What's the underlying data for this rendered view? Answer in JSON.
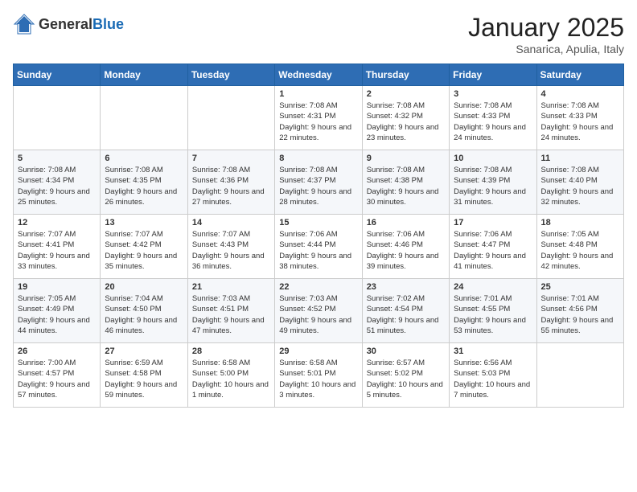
{
  "header": {
    "logo_general": "General",
    "logo_blue": "Blue",
    "month": "January 2025",
    "location": "Sanarica, Apulia, Italy"
  },
  "days_of_week": [
    "Sunday",
    "Monday",
    "Tuesday",
    "Wednesday",
    "Thursday",
    "Friday",
    "Saturday"
  ],
  "weeks": [
    [
      {
        "day": "",
        "info": ""
      },
      {
        "day": "",
        "info": ""
      },
      {
        "day": "",
        "info": ""
      },
      {
        "day": "1",
        "info": "Sunrise: 7:08 AM\nSunset: 4:31 PM\nDaylight: 9 hours and 22 minutes."
      },
      {
        "day": "2",
        "info": "Sunrise: 7:08 AM\nSunset: 4:32 PM\nDaylight: 9 hours and 23 minutes."
      },
      {
        "day": "3",
        "info": "Sunrise: 7:08 AM\nSunset: 4:33 PM\nDaylight: 9 hours and 24 minutes."
      },
      {
        "day": "4",
        "info": "Sunrise: 7:08 AM\nSunset: 4:33 PM\nDaylight: 9 hours and 24 minutes."
      }
    ],
    [
      {
        "day": "5",
        "info": "Sunrise: 7:08 AM\nSunset: 4:34 PM\nDaylight: 9 hours and 25 minutes."
      },
      {
        "day": "6",
        "info": "Sunrise: 7:08 AM\nSunset: 4:35 PM\nDaylight: 9 hours and 26 minutes."
      },
      {
        "day": "7",
        "info": "Sunrise: 7:08 AM\nSunset: 4:36 PM\nDaylight: 9 hours and 27 minutes."
      },
      {
        "day": "8",
        "info": "Sunrise: 7:08 AM\nSunset: 4:37 PM\nDaylight: 9 hours and 28 minutes."
      },
      {
        "day": "9",
        "info": "Sunrise: 7:08 AM\nSunset: 4:38 PM\nDaylight: 9 hours and 30 minutes."
      },
      {
        "day": "10",
        "info": "Sunrise: 7:08 AM\nSunset: 4:39 PM\nDaylight: 9 hours and 31 minutes."
      },
      {
        "day": "11",
        "info": "Sunrise: 7:08 AM\nSunset: 4:40 PM\nDaylight: 9 hours and 32 minutes."
      }
    ],
    [
      {
        "day": "12",
        "info": "Sunrise: 7:07 AM\nSunset: 4:41 PM\nDaylight: 9 hours and 33 minutes."
      },
      {
        "day": "13",
        "info": "Sunrise: 7:07 AM\nSunset: 4:42 PM\nDaylight: 9 hours and 35 minutes."
      },
      {
        "day": "14",
        "info": "Sunrise: 7:07 AM\nSunset: 4:43 PM\nDaylight: 9 hours and 36 minutes."
      },
      {
        "day": "15",
        "info": "Sunrise: 7:06 AM\nSunset: 4:44 PM\nDaylight: 9 hours and 38 minutes."
      },
      {
        "day": "16",
        "info": "Sunrise: 7:06 AM\nSunset: 4:46 PM\nDaylight: 9 hours and 39 minutes."
      },
      {
        "day": "17",
        "info": "Sunrise: 7:06 AM\nSunset: 4:47 PM\nDaylight: 9 hours and 41 minutes."
      },
      {
        "day": "18",
        "info": "Sunrise: 7:05 AM\nSunset: 4:48 PM\nDaylight: 9 hours and 42 minutes."
      }
    ],
    [
      {
        "day": "19",
        "info": "Sunrise: 7:05 AM\nSunset: 4:49 PM\nDaylight: 9 hours and 44 minutes."
      },
      {
        "day": "20",
        "info": "Sunrise: 7:04 AM\nSunset: 4:50 PM\nDaylight: 9 hours and 46 minutes."
      },
      {
        "day": "21",
        "info": "Sunrise: 7:03 AM\nSunset: 4:51 PM\nDaylight: 9 hours and 47 minutes."
      },
      {
        "day": "22",
        "info": "Sunrise: 7:03 AM\nSunset: 4:52 PM\nDaylight: 9 hours and 49 minutes."
      },
      {
        "day": "23",
        "info": "Sunrise: 7:02 AM\nSunset: 4:54 PM\nDaylight: 9 hours and 51 minutes."
      },
      {
        "day": "24",
        "info": "Sunrise: 7:01 AM\nSunset: 4:55 PM\nDaylight: 9 hours and 53 minutes."
      },
      {
        "day": "25",
        "info": "Sunrise: 7:01 AM\nSunset: 4:56 PM\nDaylight: 9 hours and 55 minutes."
      }
    ],
    [
      {
        "day": "26",
        "info": "Sunrise: 7:00 AM\nSunset: 4:57 PM\nDaylight: 9 hours and 57 minutes."
      },
      {
        "day": "27",
        "info": "Sunrise: 6:59 AM\nSunset: 4:58 PM\nDaylight: 9 hours and 59 minutes."
      },
      {
        "day": "28",
        "info": "Sunrise: 6:58 AM\nSunset: 5:00 PM\nDaylight: 10 hours and 1 minute."
      },
      {
        "day": "29",
        "info": "Sunrise: 6:58 AM\nSunset: 5:01 PM\nDaylight: 10 hours and 3 minutes."
      },
      {
        "day": "30",
        "info": "Sunrise: 6:57 AM\nSunset: 5:02 PM\nDaylight: 10 hours and 5 minutes."
      },
      {
        "day": "31",
        "info": "Sunrise: 6:56 AM\nSunset: 5:03 PM\nDaylight: 10 hours and 7 minutes."
      },
      {
        "day": "",
        "info": ""
      }
    ]
  ]
}
